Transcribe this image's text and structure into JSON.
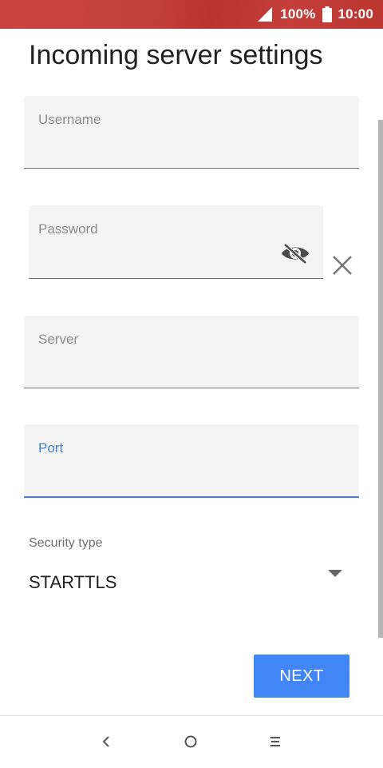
{
  "status_bar": {
    "battery": "100%",
    "time": "10:00"
  },
  "title": "Incoming server settings",
  "form": {
    "username": {
      "label": "Username",
      "value": ""
    },
    "password": {
      "label": "Password",
      "value": ""
    },
    "server": {
      "label": "Server",
      "value": ""
    },
    "port": {
      "label": "Port",
      "value": ""
    },
    "security_type": {
      "label": "Security type",
      "value": "STARTTLS"
    }
  },
  "actions": {
    "next": "NEXT"
  },
  "nav": {
    "back": "back-icon",
    "home": "home-icon",
    "recents": "menu-icon"
  },
  "colors": {
    "status_bar": "#c2413c",
    "accent": "#3f7fd4",
    "button": "#4285f4"
  }
}
